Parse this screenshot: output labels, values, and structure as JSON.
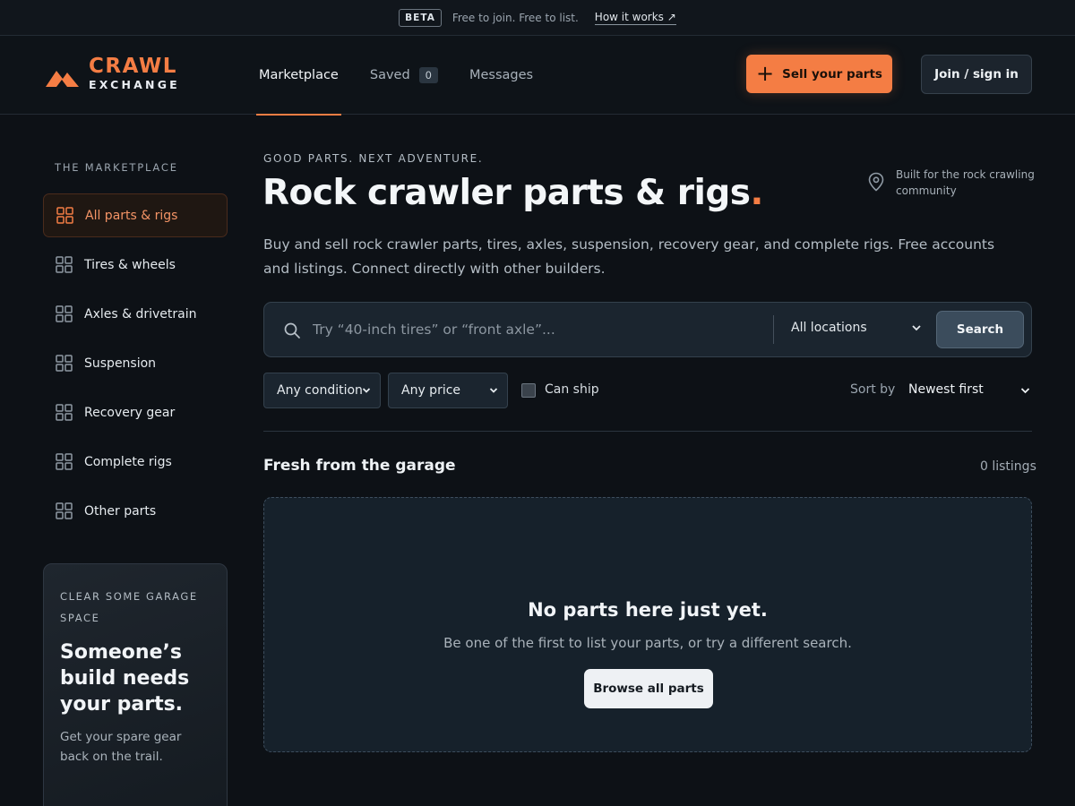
{
  "betabar": {
    "badge": "BETA",
    "text": "Free to join. Free to list.",
    "link": "How it works ↗"
  },
  "brand": {
    "line1": "CRAWL",
    "line2": "EXCHANGE",
    "accent": "#f47d44"
  },
  "nav": {
    "items": [
      {
        "label": "Marketplace",
        "active": true
      },
      {
        "label": "Saved",
        "badge": "0"
      },
      {
        "label": "Messages"
      }
    ],
    "sell_label": "Sell your parts",
    "join_label": "Join / sign in"
  },
  "sidebar": {
    "heading": "THE MARKETPLACE",
    "items": [
      {
        "label": "All parts & rigs",
        "icon": "grid-icon",
        "active": true
      },
      {
        "label": "Tires & wheels",
        "icon": "grid-icon"
      },
      {
        "label": "Axles & drivetrain",
        "icon": "grid-icon"
      },
      {
        "label": "Suspension",
        "icon": "grid-icon"
      },
      {
        "label": "Recovery gear",
        "icon": "grid-icon"
      },
      {
        "label": "Complete rigs",
        "icon": "grid-icon"
      },
      {
        "label": "Other parts",
        "icon": "grid-icon"
      }
    ],
    "promo": {
      "kicker": "CLEAR SOME GARAGE SPACE",
      "title": "Someone’s build needs your parts.",
      "sub": "Get your spare gear back on the trail."
    }
  },
  "hero": {
    "kicker": "GOOD PARTS. NEXT ADVENTURE.",
    "title": "Rock crawler parts & rigs",
    "title_dot": ".",
    "community": "Built for the rock crawling community",
    "description": "Buy and sell rock crawler parts, tires, axles, suspension, recovery gear, and complete rigs. Free accounts and listings. Connect directly with other builders."
  },
  "search": {
    "placeholder": "Try “40-inch tires” or “front axle”...",
    "value": "",
    "location": "All locations",
    "button": "Search"
  },
  "filters": {
    "condition": "Any condition",
    "price": "Any price",
    "can_ship_label": "Can ship",
    "can_ship_checked": false,
    "sort_label": "Sort by",
    "sort_value": "Newest first"
  },
  "listings": {
    "title": "Fresh from the garage",
    "count": "0 listings",
    "empty_title": "No parts here just yet.",
    "empty_sub": "Be one of the first to list your parts, or try a different search.",
    "browse_button": "Browse all parts"
  }
}
